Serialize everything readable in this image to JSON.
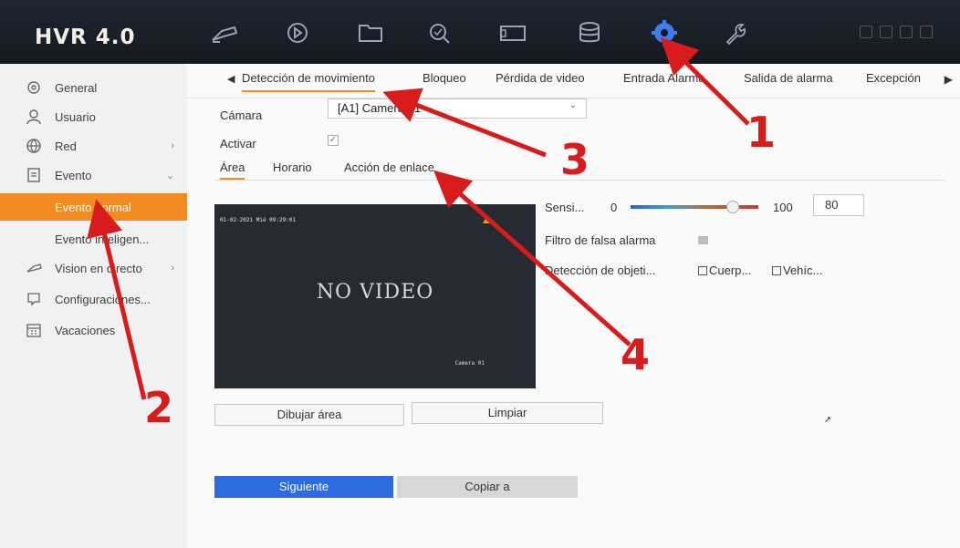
{
  "header": {
    "brand": "HVR 4.0",
    "icons": [
      "live-view-icon",
      "playback-icon",
      "files-icon",
      "search-icon",
      "camera-icon",
      "storage-icon",
      "settings-icon",
      "maintenance-icon"
    ]
  },
  "sidebar": {
    "items": [
      {
        "label": "General",
        "icon": "gear-icon"
      },
      {
        "label": "Usuario",
        "icon": "user-icon"
      },
      {
        "label": "Red",
        "icon": "globe-icon"
      },
      {
        "label": "Evento",
        "icon": "event-icon"
      },
      {
        "label": "Evento normal"
      },
      {
        "label": "Evento inteligen..."
      },
      {
        "label": "Vision en directo",
        "icon": "camera-icon"
      },
      {
        "label": "Configuraciones...",
        "icon": "chat-icon"
      },
      {
        "label": "Vacaciones",
        "icon": "calendar-icon"
      }
    ]
  },
  "tabs": [
    "Detección de movimiento",
    "Bloqueo",
    "Pérdida de video",
    "Entrada Alarma",
    "Salida de alarma",
    "Excepción"
  ],
  "form": {
    "camera_label": "Cámara",
    "camera_value": "[A1] Camera 01",
    "activar_label": "Activar"
  },
  "subtabs": [
    "Área",
    "Horario",
    "Acción de enlace"
  ],
  "video": {
    "timestamp": "01-02-2021 Mié 09:29:01",
    "no_video": "NO VIDEO",
    "camera_name": "Camera 01"
  },
  "buttons": {
    "draw": "Dibujar área",
    "clear": "Limpiar",
    "next": "Siguiente",
    "copy": "Copiar a"
  },
  "controls": {
    "sens_label": "Sensi...",
    "sens_min": "0",
    "sens_max": "100",
    "sens_value": "80",
    "sens_level": 0.8,
    "falsa_label": "Filtro de falsa alarma",
    "deteccion_label": "Detección de objeti...",
    "opt_person": "Cuerp...",
    "opt_vehicle": "Vehíc..."
  },
  "annotations": {
    "n1": "1",
    "n2": "2",
    "n3": "3",
    "n4": "4"
  },
  "colors": {
    "accent": "#f08a21",
    "primary": "#2f6be0",
    "annotation": "#d81c1c"
  }
}
